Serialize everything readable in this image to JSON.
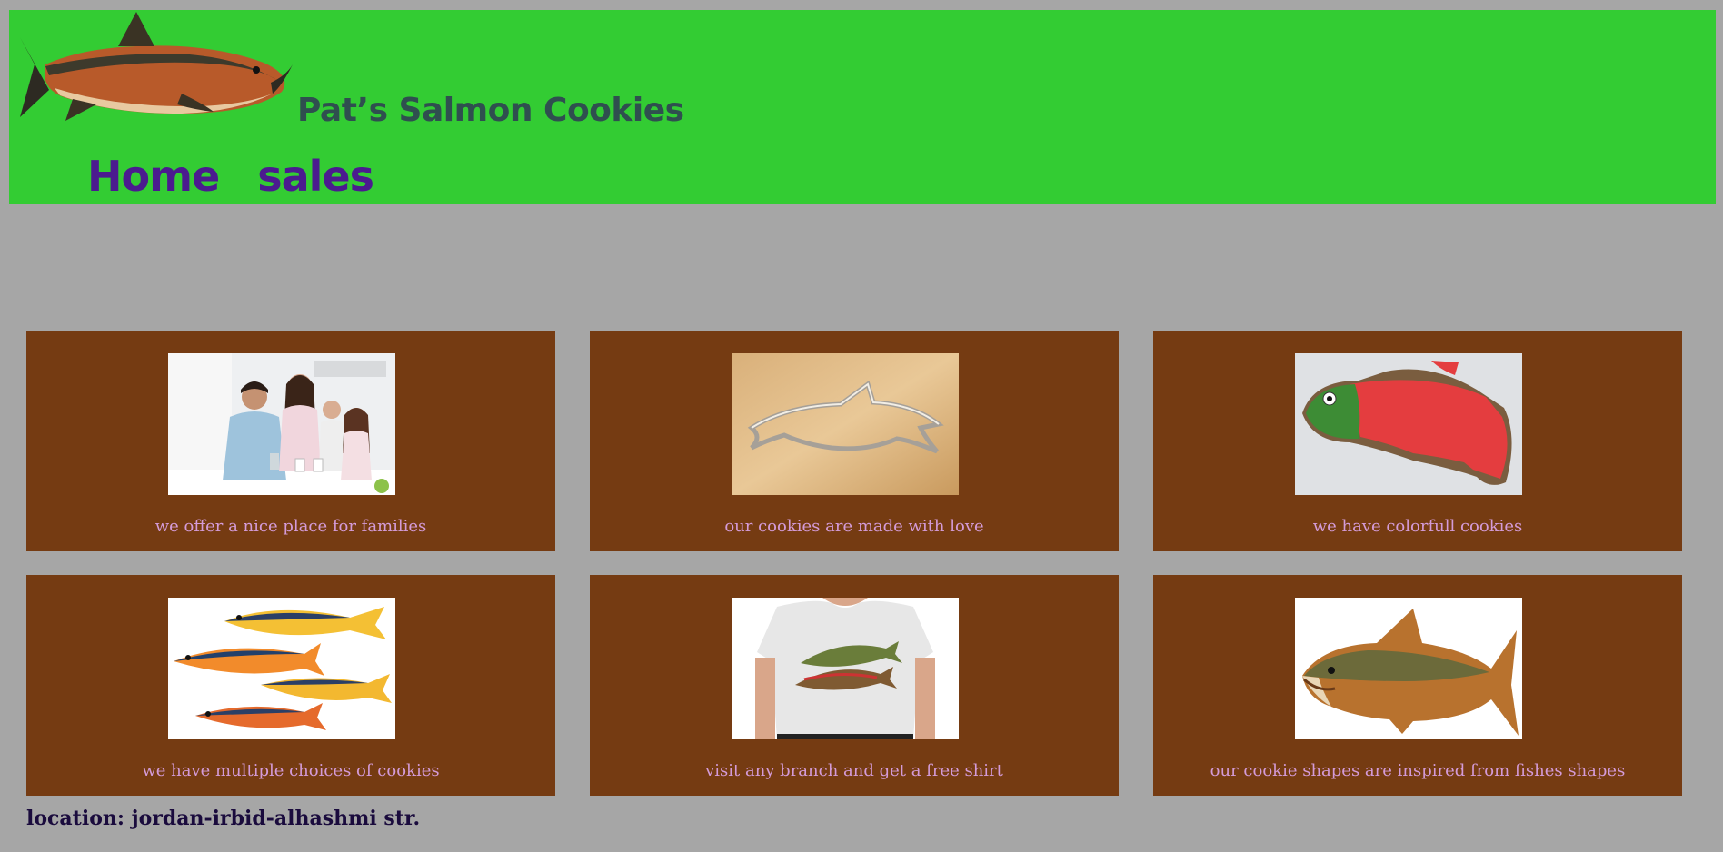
{
  "header": {
    "logo": "salmon-fish-logo",
    "title": "Pat’s Salmon Cookies",
    "nav": [
      {
        "label": "Home"
      },
      {
        "label": "sales"
      }
    ]
  },
  "cards": [
    {
      "image": "family-photo",
      "caption": "we offer a nice place for families"
    },
    {
      "image": "fish-cookie-cutter-photo",
      "caption": "our cookies are made with love"
    },
    {
      "image": "red-green-fish-cookie-photo",
      "caption": "we have colorfull cookies"
    },
    {
      "image": "painted-fishes-photo",
      "caption": "we have multiple choices of cookies"
    },
    {
      "image": "fish-tshirt-photo",
      "caption": "visit any branch and get a free shirt"
    },
    {
      "image": "salmon-photo",
      "caption": "our cookie shapes are inspired from fishes shapes"
    }
  ],
  "footer": {
    "location": "location: jordan-irbid-alhashmi str."
  },
  "colors": {
    "page_background": "#a6a6a6",
    "header_background": "#33cc33",
    "title": "#2f4f4f",
    "nav_link": "#4b1b8f",
    "card_background": "#753b12",
    "caption": "#d49bd8",
    "footer_text": "#1a0b3d"
  }
}
